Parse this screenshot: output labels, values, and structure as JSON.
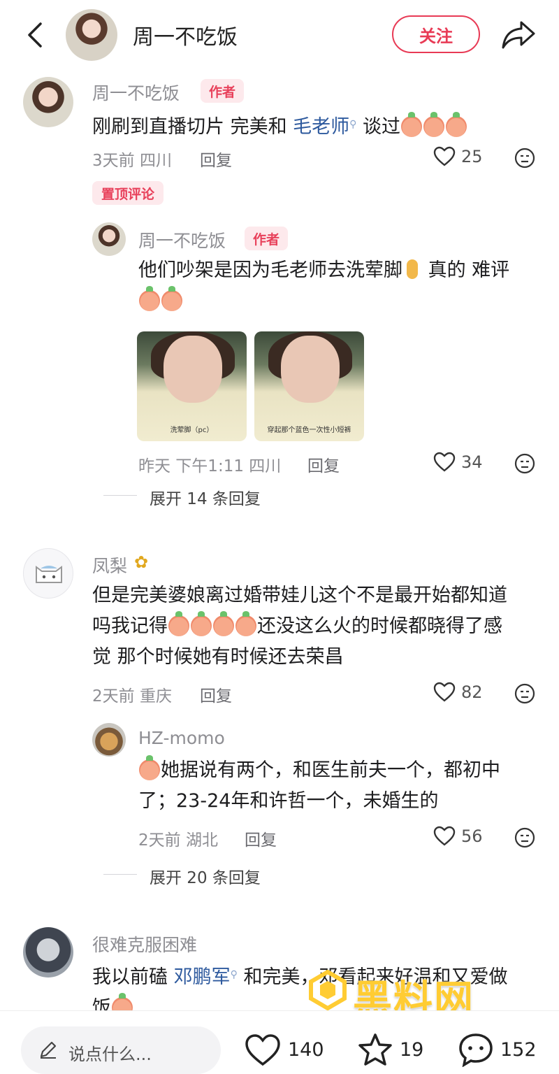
{
  "header": {
    "name": "周一不吃饭",
    "follow_label": "关注"
  },
  "comments": [
    {
      "user": "周一不吃饭",
      "tag": "作者",
      "text_a": "刚刷到直播切片 完美和 ",
      "mention": "毛老师",
      "text_b": " 谈过",
      "meta": "3天前 四川",
      "reply": "回复",
      "likes": "25",
      "pin": "置顶评论",
      "reply_item": {
        "user": "周一不吃饭",
        "tag": "作者",
        "line1": "他们吵架是因为毛老师去洗荤脚",
        "line1_b": " 真的 难评",
        "img1_caption": "洗荤脚（pc）",
        "img2_caption": "穿起那个蓝色一次性小短裤",
        "meta": "昨天 下午1:11 四川",
        "reply": "回复",
        "likes": "34"
      },
      "expand": "展开 14 条回复"
    },
    {
      "user": "凤梨",
      "line1": "但是完美婆娘离过婚带娃儿这个不是最开始都知道",
      "line2_a": "吗我记得",
      "line2_b": "还没这么火的时候都晓得了感",
      "line3": "觉 那个时候她有时候还去荣昌",
      "meta": "2天前 重庆",
      "reply": "回复",
      "likes": "82",
      "reply_item": {
        "user": "HZ-momo",
        "line1": "她据说有两个，和医生前夫一个，都初中",
        "line2": "了；23-24年和许哲一个，未婚生的",
        "meta": "2天前 湖北",
        "reply": "回复",
        "likes": "56"
      },
      "expand": "展开 20 条回复"
    },
    {
      "user": "很难克服困难",
      "text_a": "我以前磕 ",
      "mention": "邓鹏军",
      "text_b": " 和完美，邓看起来好温和又爱做",
      "line2": "饭"
    }
  ],
  "bottom_bar": {
    "placeholder": "说点什么...",
    "likes": "140",
    "stars": "19",
    "comments": "152"
  },
  "watermark": {
    "brand": "黑料网",
    "url": "https://hlwf4.com"
  }
}
